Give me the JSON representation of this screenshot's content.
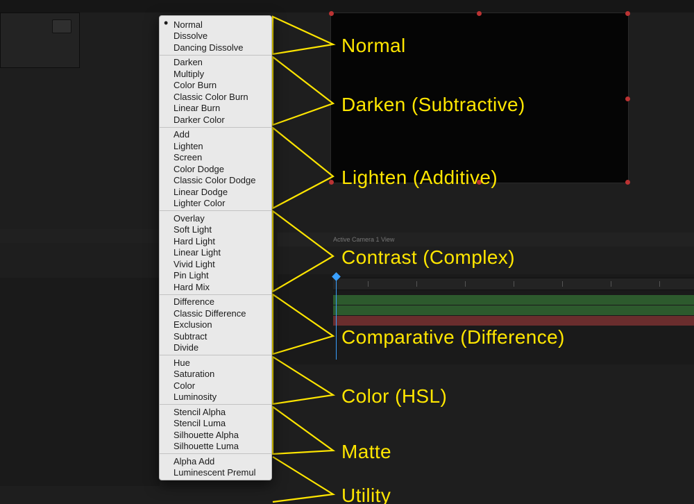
{
  "menu": {
    "selected": "Normal",
    "groups": [
      {
        "id": "normal",
        "items": [
          "Normal",
          "Dissolve",
          "Dancing Dissolve"
        ]
      },
      {
        "id": "darken",
        "items": [
          "Darken",
          "Multiply",
          "Color Burn",
          "Classic Color Burn",
          "Linear Burn",
          "Darker Color"
        ]
      },
      {
        "id": "lighten",
        "items": [
          "Add",
          "Lighten",
          "Screen",
          "Color Dodge",
          "Classic Color Dodge",
          "Linear Dodge",
          "Lighter Color"
        ]
      },
      {
        "id": "contrast",
        "items": [
          "Overlay",
          "Soft Light",
          "Hard Light",
          "Linear Light",
          "Vivid Light",
          "Pin Light",
          "Hard Mix"
        ]
      },
      {
        "id": "compare",
        "items": [
          "Difference",
          "Classic Difference",
          "Exclusion",
          "Subtract",
          "Divide"
        ]
      },
      {
        "id": "color",
        "items": [
          "Hue",
          "Saturation",
          "Color",
          "Luminosity"
        ]
      },
      {
        "id": "matte",
        "items": [
          "Stencil Alpha",
          "Stencil Luma",
          "Silhouette Alpha",
          "Silhouette Luma"
        ]
      },
      {
        "id": "utility",
        "items": [
          "Alpha Add",
          "Luminescent Premul"
        ]
      }
    ]
  },
  "annotations": {
    "normal": "Normal",
    "darken": "Darken (Subtractive)",
    "lighten": "Lighten (Additive)",
    "contrast": "Contrast (Complex)",
    "compare": "Comparative (Difference)",
    "color": "Color (HSL)",
    "matte": "Matte",
    "utility": "Utility"
  },
  "bg": {
    "toolbar_text": "Active Camera    1 View"
  }
}
